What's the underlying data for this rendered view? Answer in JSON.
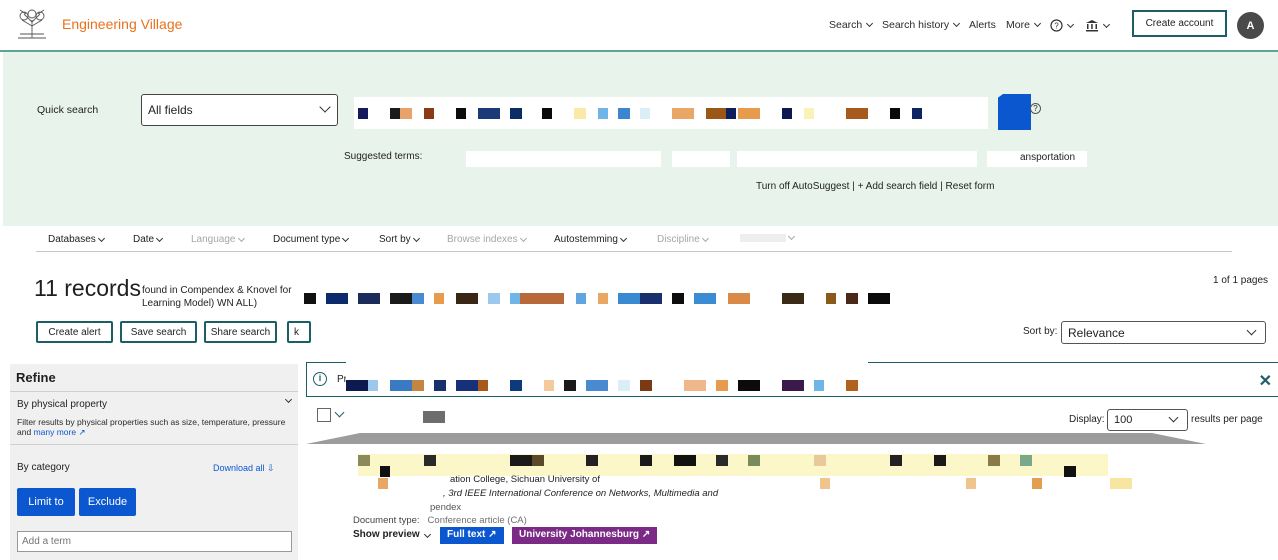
{
  "header": {
    "brand": "Engineering Village",
    "nav": {
      "search": "Search",
      "search_history": "Search history",
      "alerts": "Alerts",
      "more": "More"
    },
    "create_account": "Create account",
    "avatar_initial": "A"
  },
  "search": {
    "quick_search_label": "Quick search",
    "field_select": "All fields",
    "suggested_terms_label": "Suggested terms:",
    "suggested_term_visible": "ansportation",
    "autosuggest_toggle": "Turn off AutoSuggest",
    "add_search_field": "Add search field",
    "reset_form": "Reset form"
  },
  "filters": [
    {
      "label": "Databases",
      "enabled": true
    },
    {
      "label": "Date",
      "enabled": true
    },
    {
      "label": "Language",
      "enabled": false
    },
    {
      "label": "Document type",
      "enabled": true
    },
    {
      "label": "Sort by",
      "enabled": true
    },
    {
      "label": "Browse indexes",
      "enabled": false
    },
    {
      "label": "Autostemming",
      "enabled": true
    },
    {
      "label": "Discipline",
      "enabled": false
    }
  ],
  "results": {
    "count_text": "11 records",
    "found_text": "found in Compendex & Knovel for",
    "found_text_line2": "Learning Model) WN ALL)",
    "pages_text": "1 of 1 pages",
    "actions": {
      "create_alert": "Create alert",
      "save_search": "Save search",
      "share_search": "Share search"
    },
    "sort_by_label": "Sort by:",
    "sort_value": "Relevance",
    "display_label": "Display:",
    "display_value": "100",
    "per_page_label": "results per page"
  },
  "refine": {
    "title": "Refine",
    "physical_property_heading": "By physical property",
    "physical_property_desc": "Filter results by physical properties such as size, temperature, pressure and",
    "many_more": "many more",
    "category_heading": "By category",
    "download_all": "Download all",
    "limit_to": "Limit to",
    "exclude": "Exclude",
    "add_term_placeholder": "Add a term"
  },
  "banner": {
    "text_visible": "Pr"
  },
  "result_item": {
    "affiliation_line": "ation College, Sichuan University of",
    "conference_line": ", 3rd IEEE International Conference on Networks, Multimedia and",
    "database_line": "pendex",
    "document_type_label": "Document type:",
    "document_type_value": "Conference article (CA)",
    "show_preview": "Show preview",
    "full_text_button": "Full text",
    "university_button": "University Johannesburg"
  },
  "colors": {
    "brand_orange": "#e9711c",
    "teal_accent": "#1c5e66",
    "search_panel_bg": "#e8f3ec",
    "primary_blue": "#0b57d0",
    "university_tag": "#7b2a86"
  }
}
